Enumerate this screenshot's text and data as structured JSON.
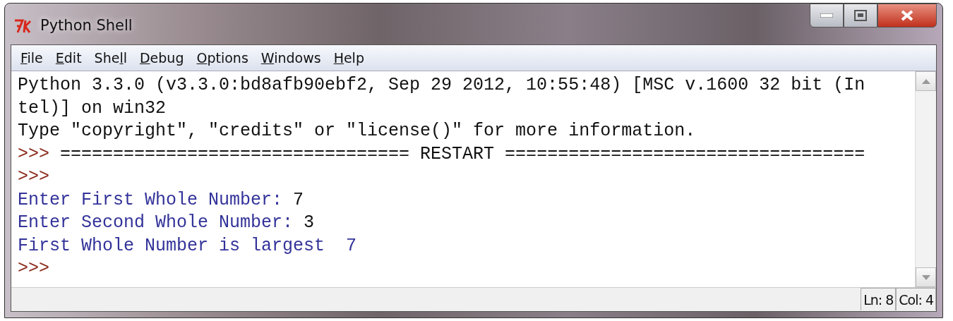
{
  "window": {
    "title": "Python Shell"
  },
  "menu": [
    {
      "key": "F",
      "after": "ile"
    },
    {
      "key": "E",
      "after": "dit"
    },
    {
      "before": "She",
      "key": "l",
      "after": "l"
    },
    {
      "key": "D",
      "after": "ebug"
    },
    {
      "key": "O",
      "after": "ptions"
    },
    {
      "key": "W",
      "after": "indows"
    },
    {
      "key": "H",
      "after": "elp"
    }
  ],
  "shell_lines": [
    {
      "segments": [
        {
          "kind": "info",
          "text": "Python 3.3.0 (v3.3.0:bd8afb90ebf2, Sep 29 2012, 10:55:48) [MSC v.1600 32 bit (In"
        }
      ]
    },
    {
      "segments": [
        {
          "kind": "info",
          "text": "tel)] on win32"
        }
      ]
    },
    {
      "segments": [
        {
          "kind": "info",
          "text": "Type \"copyright\", \"credits\" or \"license()\" for more information."
        }
      ]
    },
    {
      "segments": [
        {
          "kind": "prompt",
          "text": ">>> "
        },
        {
          "kind": "info",
          "text": "================================= RESTART =================================="
        }
      ]
    },
    {
      "segments": [
        {
          "kind": "prompt",
          "text": ">>>"
        }
      ]
    },
    {
      "segments": [
        {
          "kind": "stdout",
          "text": "Enter First Whole Number: "
        },
        {
          "kind": "stdin",
          "text": "7"
        }
      ]
    },
    {
      "segments": [
        {
          "kind": "stdout",
          "text": "Enter Second Whole Number: "
        },
        {
          "kind": "stdin",
          "text": "3"
        }
      ]
    },
    {
      "segments": [
        {
          "kind": "stdout",
          "text": "First Whole Number is largest  7"
        }
      ]
    },
    {
      "segments": [
        {
          "kind": "prompt",
          "text": ">>>"
        }
      ]
    }
  ],
  "status_bar": [
    {
      "text": "Ln: 8"
    },
    {
      "text": "Col: 4"
    }
  ]
}
